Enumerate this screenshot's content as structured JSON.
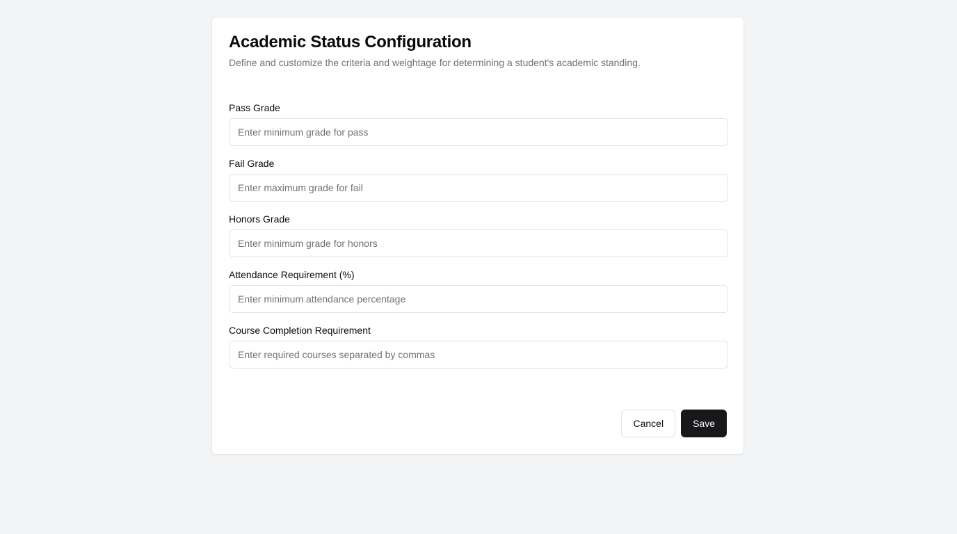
{
  "header": {
    "title": "Academic Status Configuration",
    "subtitle": "Define and customize the criteria and weightage for determining a student's academic standing."
  },
  "fields": [
    {
      "label": "Pass Grade",
      "placeholder": "Enter minimum grade for pass",
      "value": ""
    },
    {
      "label": "Fail Grade",
      "placeholder": "Enter maximum grade for fail",
      "value": ""
    },
    {
      "label": "Honors Grade",
      "placeholder": "Enter minimum grade for honors",
      "value": ""
    },
    {
      "label": "Attendance Requirement (%)",
      "placeholder": "Enter minimum attendance percentage",
      "value": ""
    },
    {
      "label": "Course Completion Requirement",
      "placeholder": "Enter required courses separated by commas",
      "value": ""
    }
  ],
  "actions": {
    "cancel_label": "Cancel",
    "save_label": "Save"
  },
  "colors": {
    "background": "#f3f4f6",
    "primary_button": "#18181b",
    "muted_text": "#71717a"
  }
}
